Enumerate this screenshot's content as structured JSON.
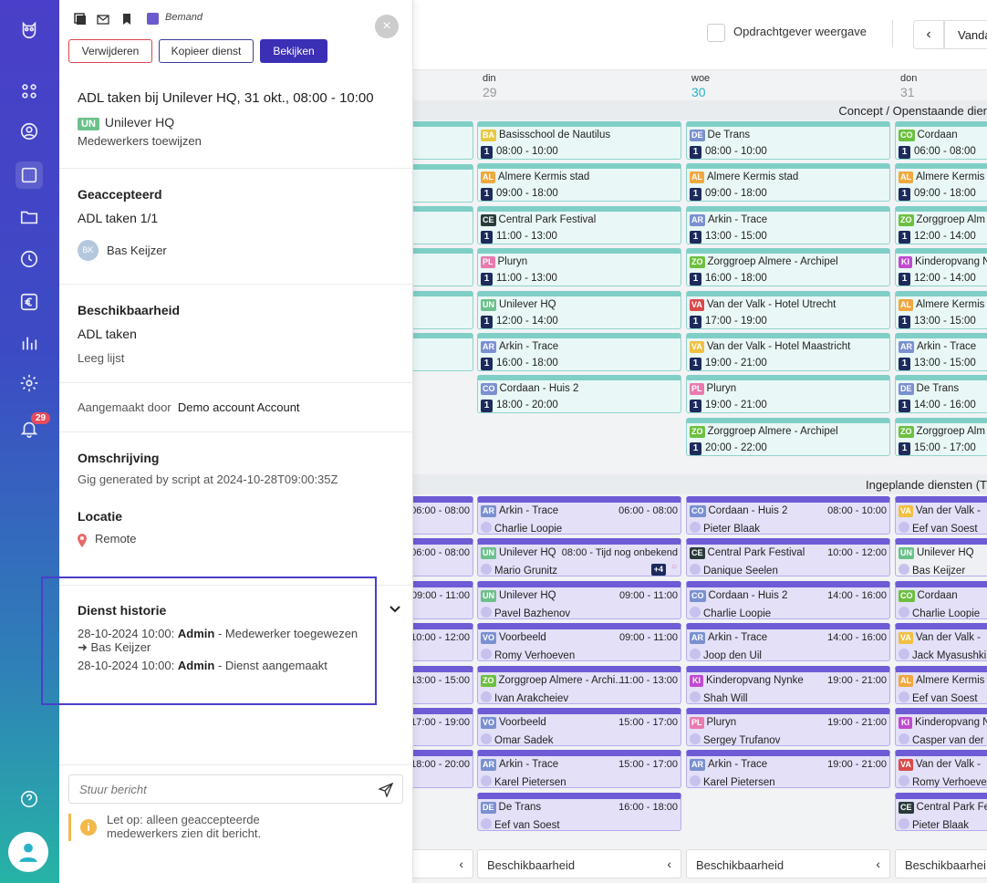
{
  "nav": {
    "notification_count": "29"
  },
  "panel": {
    "status_label": "Bemand",
    "buttons": {
      "delete": "Verwijderen",
      "copy": "Kopieer dienst",
      "view": "Bekijken"
    },
    "shift_title": "ADL taken bij Unilever HQ, 31 okt., 08:00 - 10:00",
    "client_tag": "UN",
    "client_name": "Unilever HQ",
    "assign_link": "Medewerkers toewijzen",
    "accepted": {
      "heading": "Geaccepteerd",
      "task": "ADL taken 1/1",
      "employee_initials": "BK",
      "employee_name": "Bas Keijzer"
    },
    "availability": {
      "heading": "Beschikbaarheid",
      "task": "ADL taken",
      "empty": "Leeg lijst"
    },
    "created_by_label": "Aangemaakt door",
    "created_by": "Demo account Account",
    "description": {
      "heading": "Omschrijving",
      "text": "Gig generated by script at 2024-10-28T09:00:35Z"
    },
    "location": {
      "heading": "Locatie",
      "text": "Remote"
    },
    "history": {
      "heading": "Dienst historie",
      "entries": [
        {
          "time": "28-10-2024 10:00:",
          "who": "Admin",
          "what": "- Medewerker toegewezen",
          "detail": "➜ Bas Keijzer"
        },
        {
          "time": "28-10-2024 10:00:",
          "who": "Admin",
          "what": "- Dienst aangemaakt",
          "detail": ""
        }
      ]
    },
    "message_placeholder": "Stuur bericht",
    "warning": "Let op: alleen geaccepteerde medewerkers zien dit bericht."
  },
  "calendar": {
    "client_view_label": "Opdrachtgever weergave",
    "today_label": "Vanda",
    "days": [
      {
        "name": "din",
        "num": "29"
      },
      {
        "name": "woe",
        "num": "30"
      },
      {
        "name": "don",
        "num": "31"
      }
    ],
    "open_section": "Concept / Openstaande dier",
    "planned_section": "Ingeplande diensten (T",
    "open_cols": [
      [
        {
          "tag": "BA",
          "color": "#e8c840",
          "name": "Basisschool de Nautilus",
          "count": "1",
          "time": "08:00 - 10:00"
        },
        {
          "tag": "AL",
          "color": "#f0a840",
          "name": "Almere Kermis stad",
          "count": "1",
          "time": "09:00 - 18:00"
        },
        {
          "tag": "CE",
          "color": "#2a3a3a",
          "name": "Central Park Festival",
          "count": "1",
          "time": "11:00 - 13:00"
        },
        {
          "tag": "PL",
          "color": "#e87ab0",
          "name": "Pluryn",
          "count": "1",
          "time": "11:00 - 13:00"
        },
        {
          "tag": "UN",
          "color": "#6cc08b",
          "name": "Unilever HQ",
          "count": "1",
          "time": "12:00 - 14:00"
        },
        {
          "tag": "AR",
          "color": "#7a90d0",
          "name": "Arkin - Trace",
          "count": "1",
          "time": "16:00 - 18:00"
        },
        {
          "tag": "CO",
          "color": "#7a90d0",
          "name": "Cordaan - Huis 2",
          "count": "1",
          "time": "18:00 - 20:00"
        }
      ],
      [
        {
          "tag": "DE",
          "color": "#7a90d0",
          "name": "De Trans",
          "count": "1",
          "time": "08:00 - 10:00"
        },
        {
          "tag": "AL",
          "color": "#f0a840",
          "name": "Almere Kermis stad",
          "count": "1",
          "time": "09:00 - 18:00"
        },
        {
          "tag": "AR",
          "color": "#7a90d0",
          "name": "Arkin - Trace",
          "count": "1",
          "time": "13:00 - 15:00"
        },
        {
          "tag": "ZO",
          "color": "#6cc040",
          "name": "Zorggroep Almere - Archipel",
          "count": "1",
          "time": "16:00 - 18:00"
        },
        {
          "tag": "VA",
          "color": "#d94a4a",
          "name": "Van der Valk - Hotel Utrecht",
          "count": "1",
          "time": "17:00 - 19:00"
        },
        {
          "tag": "VA",
          "color": "#f0c040",
          "name": "Van der Valk - Hotel Maastricht",
          "count": "1",
          "time": "19:00 - 21:00"
        },
        {
          "tag": "PL",
          "color": "#e87ab0",
          "name": "Pluryn",
          "count": "1",
          "time": "19:00 - 21:00"
        },
        {
          "tag": "ZO",
          "color": "#6cc040",
          "name": "Zorggroep Almere - Archipel",
          "count": "1",
          "time": "20:00 - 22:00"
        }
      ],
      [
        {
          "tag": "CO",
          "color": "#6cc040",
          "name": "Cordaan",
          "count": "1",
          "time": "06:00 - 08:00"
        },
        {
          "tag": "AL",
          "color": "#f0a840",
          "name": "Almere Kermis s",
          "count": "1",
          "time": "09:00 - 18:00"
        },
        {
          "tag": "ZO",
          "color": "#6cc040",
          "name": "Zorggroep Alm",
          "count": "1",
          "time": "12:00 - 14:00"
        },
        {
          "tag": "KI",
          "color": "#c04ad0",
          "name": "Kinderopvang N",
          "count": "1",
          "time": "12:00 - 14:00"
        },
        {
          "tag": "AL",
          "color": "#f0a840",
          "name": "Almere Kermis s",
          "count": "1",
          "time": "13:00 - 15:00"
        },
        {
          "tag": "AR",
          "color": "#7a90d0",
          "name": "Arkin - Trace",
          "count": "1",
          "time": "13:00 - 15:00"
        },
        {
          "tag": "DE",
          "color": "#7a90d0",
          "name": "De Trans",
          "count": "1",
          "time": "14:00 - 16:00"
        },
        {
          "tag": "ZO",
          "color": "#6cc040",
          "name": "Zorggroep Alm",
          "count": "1",
          "time": "15:00 - 17:00"
        }
      ]
    ],
    "planned_partial_times": [
      "06:00 - 08:00",
      "06:00 - 08:00",
      "09:00 - 11:00",
      "10:00 - 12:00",
      "13:00 - 15:00",
      "17:00 - 19:00",
      "18:00 - 20:00"
    ],
    "planned_cols": [
      [
        {
          "tag": "AR",
          "color": "#7a90d0",
          "name": "Arkin - Trace",
          "time": "06:00 - 08:00",
          "person": "Charlie Loopie"
        },
        {
          "tag": "UN",
          "color": "#6cc08b",
          "name": "Unilever HQ",
          "time": "08:00 - Tijd nog onbekend",
          "person": "Mario Grunitz",
          "extra": "+4"
        },
        {
          "tag": "UN",
          "color": "#6cc08b",
          "name": "Unilever HQ",
          "time": "09:00 - 11:00",
          "person": "Pavel Bazhenov"
        },
        {
          "tag": "VO",
          "color": "#7a90d0",
          "name": "Voorbeeld",
          "time": "09:00 - 11:00",
          "person": "Romy Verhoeven"
        },
        {
          "tag": "ZO",
          "color": "#6cc040",
          "name": "Zorggroep Almere - Archi...",
          "time": "11:00 - 13:00",
          "person": "Ivan Arakcheiev"
        },
        {
          "tag": "VO",
          "color": "#7a90d0",
          "name": "Voorbeeld",
          "time": "15:00 - 17:00",
          "person": "Omar Sadek"
        },
        {
          "tag": "AR",
          "color": "#7a90d0",
          "name": "Arkin - Trace",
          "time": "15:00 - 17:00",
          "person": "Karel Pietersen"
        },
        {
          "tag": "DE",
          "color": "#7a90d0",
          "name": "De Trans",
          "time": "16:00 - 18:00",
          "person": "Eef van Soest"
        }
      ],
      [
        {
          "tag": "CO",
          "color": "#7a90d0",
          "name": "Cordaan - Huis 2",
          "time": "08:00 - 10:00",
          "person": "Pieter Blaak"
        },
        {
          "tag": "CE",
          "color": "#2a3a3a",
          "name": "Central Park Festival",
          "time": "10:00 - 12:00",
          "person": "Danique Seelen"
        },
        {
          "tag": "CO",
          "color": "#7a90d0",
          "name": "Cordaan - Huis 2",
          "time": "14:00 - 16:00",
          "person": "Charlie Loopie"
        },
        {
          "tag": "AR",
          "color": "#7a90d0",
          "name": "Arkin - Trace",
          "time": "14:00 - 16:00",
          "person": "Joop den Uil"
        },
        {
          "tag": "KI",
          "color": "#c04ad0",
          "name": "Kinderopvang Nynke",
          "time": "19:00 - 21:00",
          "person": "Shah Will"
        },
        {
          "tag": "PL",
          "color": "#e87ab0",
          "name": "Pluryn",
          "time": "19:00 - 21:00",
          "person": "Sergey Trufanov"
        },
        {
          "tag": "AR",
          "color": "#7a90d0",
          "name": "Arkin - Trace",
          "time": "19:00 - 21:00",
          "person": "Karel Pietersen"
        }
      ],
      [
        {
          "tag": "VA",
          "color": "#f0c040",
          "name": "Van der Valk -",
          "time": "",
          "person": "Eef van Soest"
        },
        {
          "tag": "UN",
          "color": "#6cc08b",
          "name": "Unilever HQ",
          "time": "",
          "person": "Bas Keijzer"
        },
        {
          "tag": "CO",
          "color": "#6cc040",
          "name": "Cordaan",
          "time": "",
          "person": "Charlie Loopie"
        },
        {
          "tag": "VA",
          "color": "#f0c040",
          "name": "Van der Valk -",
          "time": "",
          "person": "Jack Myasushki"
        },
        {
          "tag": "AL",
          "color": "#f0a840",
          "name": "Almere Kermis",
          "time": "",
          "person": "Eef van Soest"
        },
        {
          "tag": "KI",
          "color": "#c04ad0",
          "name": "Kinderopvang N",
          "time": "",
          "person": "Casper van der"
        },
        {
          "tag": "VA",
          "color": "#d94a4a",
          "name": "Van der Valk -",
          "time": "",
          "person": "Romy Verhoeven"
        },
        {
          "tag": "CE",
          "color": "#2a3a3a",
          "name": "Central Park Fe",
          "time": "",
          "person": "Pieter Blaak"
        }
      ]
    ],
    "bottom_labels": [
      "Beschikbaarheid",
      "Beschikbaarheid",
      "Beschikbaarhei"
    ]
  }
}
